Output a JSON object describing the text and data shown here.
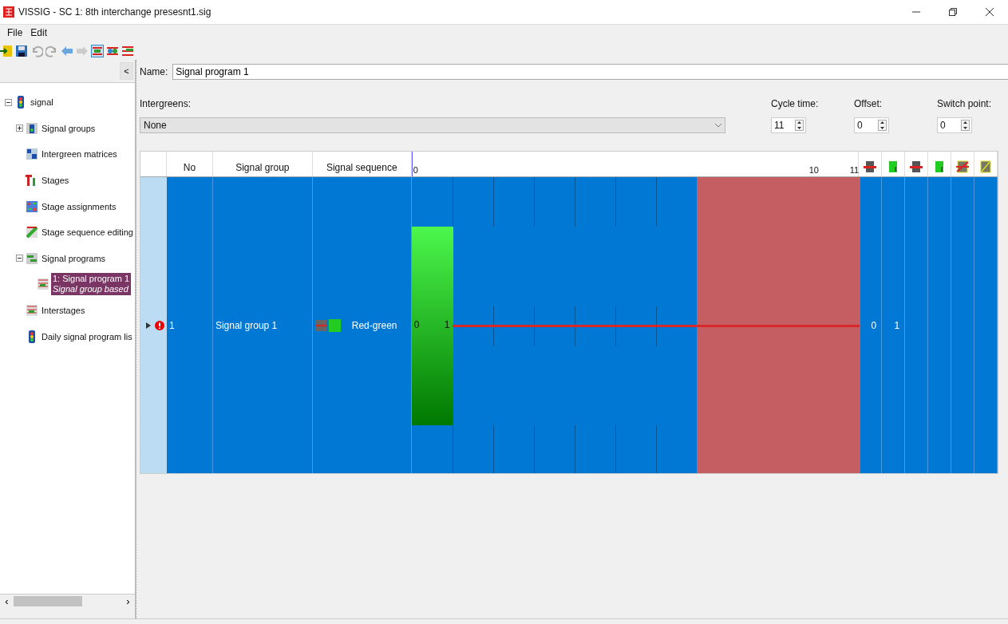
{
  "window": {
    "title": "VISSIG - SC 1: 8th interchange presesnt1.sig"
  },
  "menu": [
    "File",
    "Edit"
  ],
  "sidebar": {
    "collapse_button": "<",
    "tree": [
      {
        "label": "signal",
        "selected": false,
        "expanded": true,
        "children": [
          {
            "label": "Signal groups",
            "selected": false,
            "expanded": false
          },
          {
            "label": "Intergreen matrices",
            "selected": false
          },
          {
            "label": "Stages",
            "selected": false
          },
          {
            "label": "Stage assignments",
            "selected": false
          },
          {
            "label": "Stage sequence editing",
            "selected": false
          },
          {
            "label": "Signal programs",
            "selected": false,
            "expanded": true,
            "children": [
              {
                "label": "1: Signal program 1",
                "sublabel": "Signal group based",
                "selected": true
              }
            ]
          },
          {
            "label": "Interstages",
            "selected": false
          },
          {
            "label": "Daily signal program lis",
            "selected": false
          }
        ]
      }
    ],
    "scroll_right": "›",
    "scroll_left": "‹"
  },
  "form": {
    "name_label": "Name:",
    "name_value": "Signal program 1",
    "intergreens_label": "Intergreens:",
    "intergreens_value": "None",
    "spinners": [
      {
        "label": "Cycle time:",
        "value": "11"
      },
      {
        "label": "Offset:",
        "value": "0"
      },
      {
        "label": "Switch point:",
        "value": "0"
      }
    ]
  },
  "table": {
    "columns": [
      "No",
      "Signal group",
      "Signal sequence"
    ],
    "timeline_ticks": [
      "0",
      "10",
      "11"
    ],
    "rows": [
      {
        "selected": true,
        "error": true,
        "no": "1",
        "signal_group": "Signal group 1",
        "sequence": "Red-green",
        "green_start": "0",
        "green_end": "1",
        "column_4": "0",
        "column_5": "1"
      }
    ]
  }
}
